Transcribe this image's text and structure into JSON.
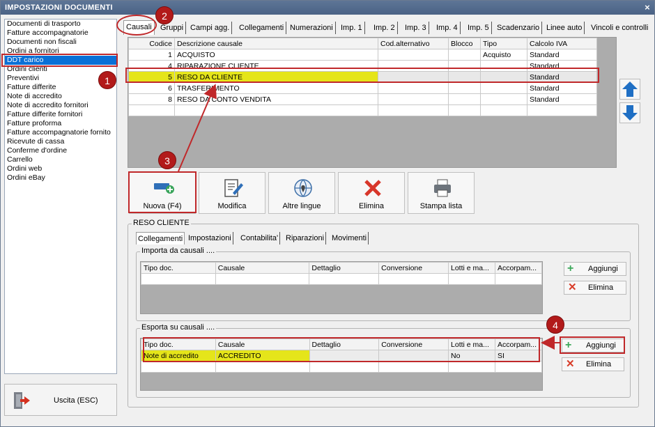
{
  "window": {
    "title": "IMPOSTAZIONI DOCUMENTI",
    "close_glyph": "×"
  },
  "sidebar": {
    "items": [
      {
        "label": "Documenti di trasporto"
      },
      {
        "label": "Fatture accompagnatorie"
      },
      {
        "label": "Documenti non fiscali"
      },
      {
        "label": "Ordini a fornitori"
      },
      {
        "label": "DDT carico",
        "selected": true
      },
      {
        "label": "Ordini clienti"
      },
      {
        "label": "Preventivi"
      },
      {
        "label": "Fatture differite"
      },
      {
        "label": "Note di accredito"
      },
      {
        "label": "Note di accredito fornitori"
      },
      {
        "label": "Fatture differite fornitori"
      },
      {
        "label": "Fatture proforma"
      },
      {
        "label": "Fatture accompagnatorie fornito"
      },
      {
        "label": "Ricevute di cassa"
      },
      {
        "label": "Conferme d'ordine"
      },
      {
        "label": "Carrello"
      },
      {
        "label": "Ordini web"
      },
      {
        "label": "Ordini eBay"
      }
    ],
    "exit_label": "Uscita (ESC)"
  },
  "tabs": [
    "Causali",
    "Gruppi",
    "Campi agg.",
    "Collegamenti",
    "Numerazioni",
    "Imp. 1",
    "Imp. 2",
    "Imp. 3",
    "Imp. 4",
    "Imp. 5",
    "Scadenzario",
    "Linee auto",
    "Vincoli e controlli"
  ],
  "main_grid": {
    "columns": [
      "Codice",
      "Descrizione causale",
      "Cod.alternativo",
      "Blocco",
      "Tipo",
      "Calcolo IVA"
    ],
    "rows": [
      {
        "codice": "1",
        "descrizione": "ACQUISTO",
        "cod_alt": "",
        "blocco": "",
        "tipo": "Acquisto",
        "iva": "Standard"
      },
      {
        "codice": "4",
        "descrizione": "RIPARAZIONE CLIENTE",
        "cod_alt": "",
        "blocco": "",
        "tipo": "",
        "iva": "Standard"
      },
      {
        "codice": "5",
        "descrizione": "RESO DA CLIENTE",
        "cod_alt": "",
        "blocco": "",
        "tipo": "",
        "iva": "Standard",
        "highlighted": true
      },
      {
        "codice": "6",
        "descrizione": "TRASFERIMENTO",
        "cod_alt": "",
        "blocco": "",
        "tipo": "",
        "iva": "Standard"
      },
      {
        "codice": "8",
        "descrizione": "RESO DA CONTO VENDITA",
        "cod_alt": "",
        "blocco": "",
        "tipo": "",
        "iva": "Standard"
      }
    ]
  },
  "toolbar": {
    "new": "Nuova (F4)",
    "edit": "Modifica",
    "languages": "Altre lingue",
    "delete": "Elimina",
    "print": "Stampa lista"
  },
  "detail": {
    "title": "RESO CLIENTE",
    "subtabs": [
      "Collegamenti",
      "Impostazioni",
      "Contabilita'",
      "Riparazioni",
      "Movimenti"
    ],
    "import_group": {
      "title": "Importa da causali ....",
      "columns": [
        "Tipo doc.",
        "Causale",
        "Dettaglio",
        "Conversione",
        "Lotti e ma...",
        "Accorpam..."
      ],
      "add": "Aggiungi",
      "remove": "Elimina"
    },
    "export_group": {
      "title": "Esporta su causali ....",
      "columns": [
        "Tipo doc.",
        "Causale",
        "Dettaglio",
        "Conversione",
        "Lotti e ma...",
        "Accorpam..."
      ],
      "rows": [
        {
          "tipo": "Note di accredito",
          "causale": "ACCREDITO",
          "dettaglio": "",
          "conversione": "",
          "lotti": "No",
          "accorp": "SI"
        }
      ],
      "add": "Aggiungi",
      "remove": "Elimina"
    }
  },
  "badges": [
    "1",
    "2",
    "3",
    "4"
  ],
  "colors": {
    "accent_red": "#c0282a",
    "highlight_yellow": "#e5e51a",
    "selection_blue": "#0a70d6"
  }
}
